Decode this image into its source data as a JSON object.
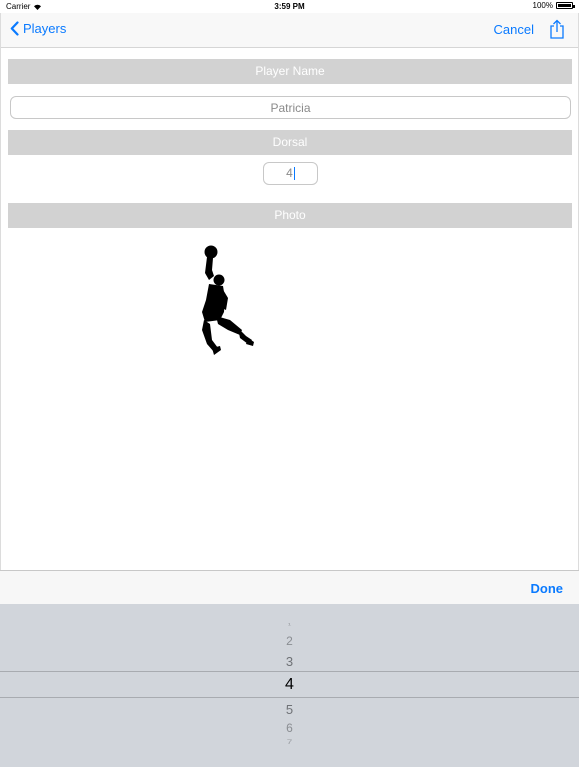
{
  "status_bar": {
    "carrier": "Carrier",
    "time": "3:59 PM",
    "battery": "100%",
    "battery_level": 1.0
  },
  "nav_bar": {
    "back_label": "Players",
    "cancel_label": "Cancel",
    "share_icon": "share-icon"
  },
  "form": {
    "player_name_header": "Player Name",
    "player_name_value": "Patricia",
    "dorsal_header": "Dorsal",
    "dorsal_value": "4",
    "photo_header": "Photo",
    "photo_icon": "basketball-player-silhouette"
  },
  "picker_toolbar": {
    "done_label": "Done"
  },
  "picker": {
    "rows": [
      "1",
      "2",
      "3",
      "4",
      "5",
      "6",
      "7"
    ],
    "selected": "4"
  },
  "colors": {
    "accent": "#0a7aff",
    "header_bg": "#d2d2d2",
    "picker_bg": "#d1d5db"
  }
}
